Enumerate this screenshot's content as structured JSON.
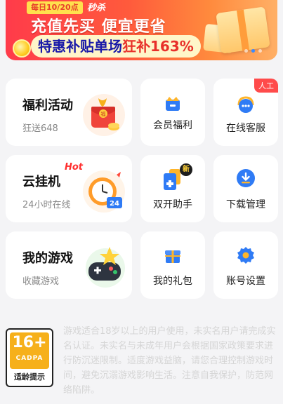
{
  "banner": {
    "tag": "每日10/20点",
    "seckill": "秒杀",
    "headline": "充值先买 便宜更省",
    "pill_prefix": "特惠补贴单场",
    "pill_highlight": "狂补163%",
    "active_dot": 1
  },
  "big_cards": [
    {
      "title": "福利活动",
      "subtitle": "狂送648",
      "icon": "red-envelope-icon"
    },
    {
      "title": "云挂机",
      "subtitle": "24小时在线",
      "icon": "alarm-clock-icon",
      "hot": "Hot",
      "clock_number": "24"
    },
    {
      "title": "我的游戏",
      "subtitle": "收藏游戏",
      "icon": "gamepad-icon"
    }
  ],
  "small_cards": [
    {
      "label": "会员福利",
      "icon": "crown-icon"
    },
    {
      "label": "在线客服",
      "icon": "headset-icon",
      "badge": "人工"
    },
    {
      "label": "双开助手",
      "icon": "dual-open-icon",
      "badge": "新"
    },
    {
      "label": "下载管理",
      "icon": "download-icon"
    },
    {
      "label": "我的礼包",
      "icon": "gift-icon"
    },
    {
      "label": "账号设置",
      "icon": "settings-gear-icon"
    }
  ],
  "age_rating": {
    "number": "16+",
    "org": "CADPA",
    "label": "适龄提示"
  },
  "notice": "游戏适合18岁以上的用户使用，未实名用户请完成实名认证。未实名与未成年用户会根据国家政策要求进行防沉迷限制。适度游戏益脑，请您合理控制游戏时间，避免沉溺游戏影响生活。注意自我保护，防范网络陷阱。",
  "colors": {
    "accent_blue": "#2f7bf5",
    "orange": "#f6b01b",
    "hot_red": "#ff2d2d"
  }
}
